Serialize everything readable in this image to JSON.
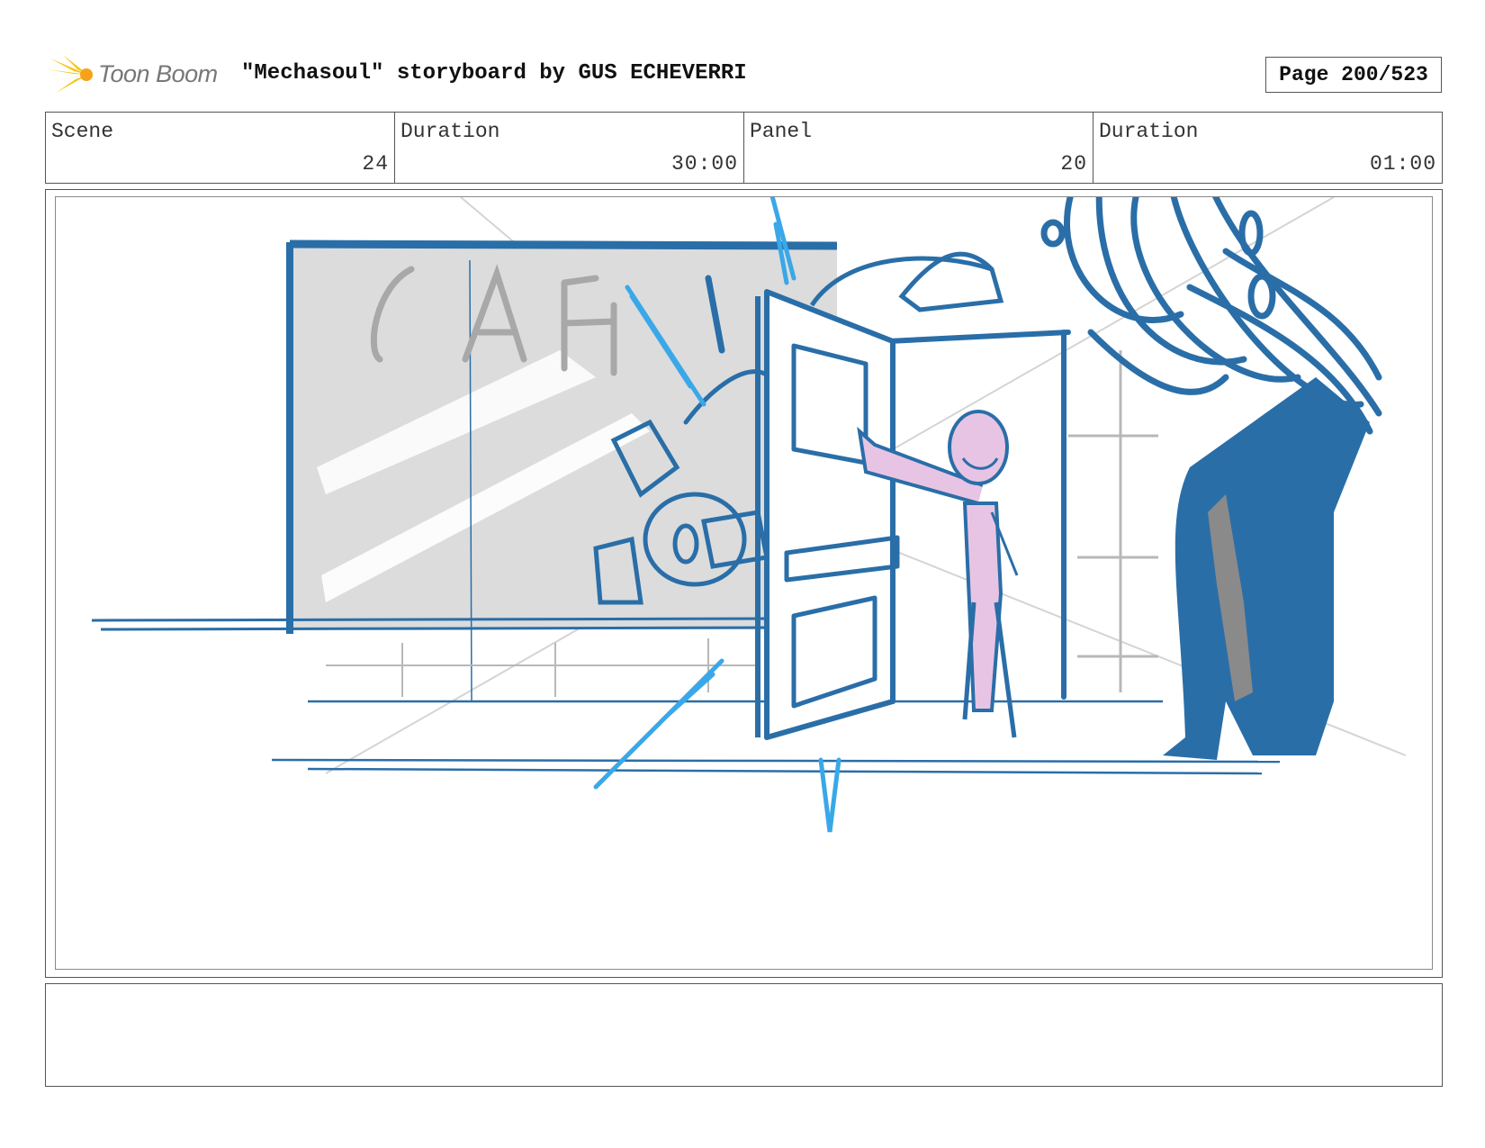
{
  "header": {
    "logo_text": "Toon Boom",
    "title": "\"Mechasoul\" storyboard by GUS ECHEVERRI",
    "page": "Page 200/523"
  },
  "info": [
    {
      "label": "Scene",
      "value": "24"
    },
    {
      "label": "Duration",
      "value": "30:00"
    },
    {
      "label": "Panel",
      "value": "20"
    },
    {
      "label": "Duration",
      "value": "01:00"
    }
  ],
  "panel": {
    "sign_text": "CAF"
  },
  "notes": "",
  "colors": {
    "sketch_blue": "#2a6ea8",
    "accent_blue": "#3aa8e8",
    "character_pink": "#e8c4e4",
    "window_gray": "#dcdcdc"
  }
}
